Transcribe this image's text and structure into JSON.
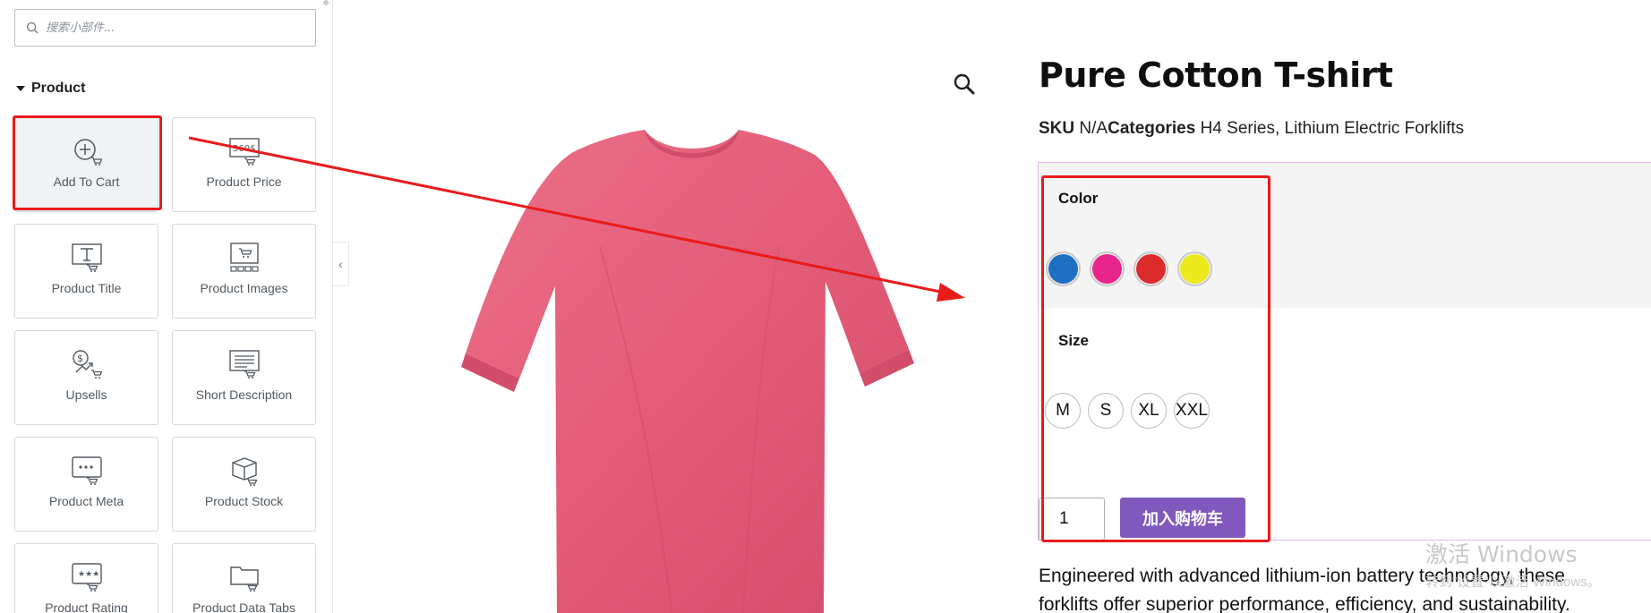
{
  "panel": {
    "search": {
      "placeholder": "搜索小部件..."
    },
    "section_title": "Product",
    "widgets": [
      {
        "label": "Add To Cart",
        "icon": "add-to-cart-icon"
      },
      {
        "label": "Product Price",
        "icon": "product-price-icon",
        "icon_text": "360$"
      },
      {
        "label": "Product Title",
        "icon": "product-title-icon"
      },
      {
        "label": "Product Images",
        "icon": "product-images-icon"
      },
      {
        "label": "Upsells",
        "icon": "upsells-icon"
      },
      {
        "label": "Short Description",
        "icon": "short-description-icon"
      },
      {
        "label": "Product Meta",
        "icon": "product-meta-icon"
      },
      {
        "label": "Product Stock",
        "icon": "product-stock-icon"
      },
      {
        "label": "Product Rating",
        "icon": "product-rating-icon"
      },
      {
        "label": "Product Data Tabs",
        "icon": "product-data-tabs-icon"
      }
    ],
    "collapse_glyph": "‹"
  },
  "product": {
    "title": "Pure Cotton T-shirt",
    "sku_label": "SKU",
    "sku_value": "N/A",
    "categories_label": "Categories",
    "categories_value": "H4 Series, Lithium Electric Forklifts",
    "color_label": "Color",
    "colors": [
      "#1e6fc3",
      "#e8258a",
      "#dc2b2b",
      "#eaea1d"
    ],
    "size_label": "Size",
    "sizes": [
      "M",
      "S",
      "XL",
      "XXL"
    ],
    "quantity": "1",
    "add_to_cart_label": "加入购物车",
    "description_lines": [
      "Engineered with advanced lithium-ion battery technology, these",
      "forklifts offer superior performance, efficiency, and sustainability."
    ],
    "tshirt_color": "#e35c78"
  },
  "watermark": {
    "line1": "激活 Windows",
    "line2": "转到\"设置\"以激活 Windows。"
  },
  "annotation": {
    "color": "#e81b1b"
  }
}
